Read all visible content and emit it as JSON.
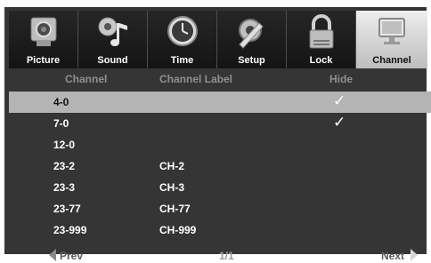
{
  "tabs": [
    {
      "label": "Picture",
      "icon": "camera-icon",
      "active": false
    },
    {
      "label": "Sound",
      "icon": "music-note-icon",
      "active": false
    },
    {
      "label": "Time",
      "icon": "clock-icon",
      "active": false
    },
    {
      "label": "Setup",
      "icon": "wrench-gear-icon",
      "active": false
    },
    {
      "label": "Lock",
      "icon": "padlock-icon",
      "active": false
    },
    {
      "label": "Channel",
      "icon": "monitor-icon",
      "active": true
    }
  ],
  "table": {
    "headers": {
      "channel": "Channel",
      "label": "Channel Label",
      "hide": "Hide"
    },
    "rows": [
      {
        "channel": "4-0",
        "label": "",
        "hidden": true,
        "selected": true
      },
      {
        "channel": "7-0",
        "label": "",
        "hidden": true,
        "selected": false
      },
      {
        "channel": "12-0",
        "label": "",
        "hidden": false,
        "selected": false
      },
      {
        "channel": "23-2",
        "label": "CH-2",
        "hidden": false,
        "selected": false
      },
      {
        "channel": "23-3",
        "label": "CH-3",
        "hidden": false,
        "selected": false
      },
      {
        "channel": "23-77",
        "label": "CH-77",
        "hidden": false,
        "selected": false
      },
      {
        "channel": "23-999",
        "label": "CH-999",
        "hidden": false,
        "selected": false
      }
    ],
    "check_mark": "✓"
  },
  "footer": {
    "prev": "Prev",
    "page": "1/1",
    "next": "Next"
  },
  "colors": {
    "background": "#353535",
    "selected_row": "#b4b4b4",
    "active_tab": "#dddddd"
  }
}
